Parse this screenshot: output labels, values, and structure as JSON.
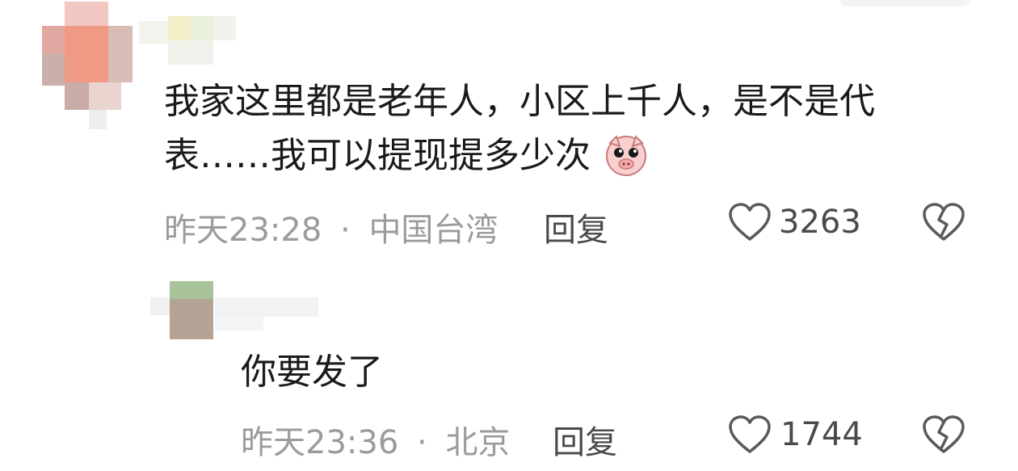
{
  "comments": [
    {
      "text_line1": "我家这里都是老年人，小区上千人，是不是代",
      "text_line2": "表……我可以提现提多少次",
      "emoji": "pig-face-emoji",
      "time": "昨天23:28",
      "dot": "·",
      "location": "中国台湾",
      "reply_label": "回复",
      "like_count": "3263"
    },
    {
      "text": "你要发了",
      "time": "昨天23:36",
      "dot": "·",
      "location": "北京",
      "reply_label": "回复",
      "like_count": "1744"
    }
  ],
  "icons": {
    "like": "heart-outline-icon",
    "dislike": "broken-heart-icon"
  },
  "colors": {
    "text": "#1a1a1a",
    "meta": "#9b9b9b",
    "reply": "#4a4a4a",
    "icon": "#5a5a5a"
  }
}
